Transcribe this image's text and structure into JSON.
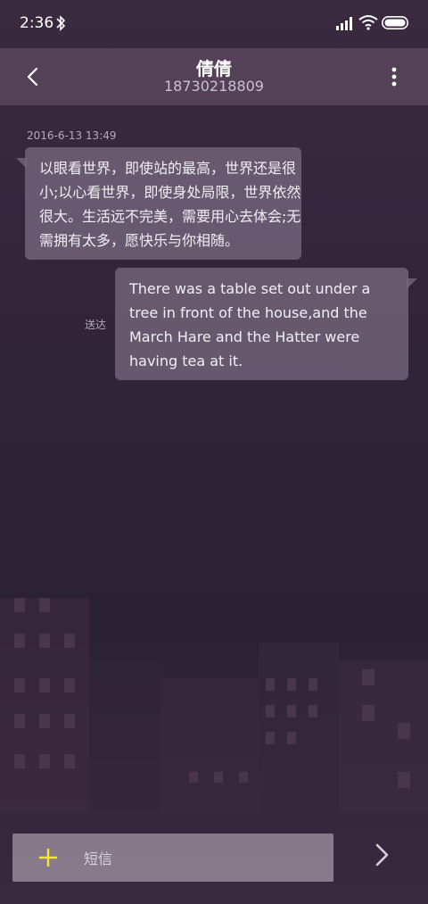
{
  "status_bar": {
    "time": "2:36"
  },
  "header": {
    "contact_name": "倩倩",
    "contact_number": "18730218809"
  },
  "conversation": {
    "timestamp": "2016-6-13 13:49",
    "messages": [
      {
        "direction": "incoming",
        "text": "以眼看世界，即使站的最高，世界还是很小;以心看世界，即使身处局限，世界依然很大。生活远不完美，需要用心去体会;无需拥有太多，愿快乐与你相随。"
      },
      {
        "direction": "outgoing",
        "text": "There was a table set out under a tree in front of the house,and the March Hare and the Hatter were having tea at it.",
        "status": "送达"
      }
    ]
  },
  "composer": {
    "placeholder": "短信",
    "value": ""
  },
  "colors": {
    "accent": "#f5e43a",
    "bubble": "#76687d",
    "header": "#785f78"
  }
}
